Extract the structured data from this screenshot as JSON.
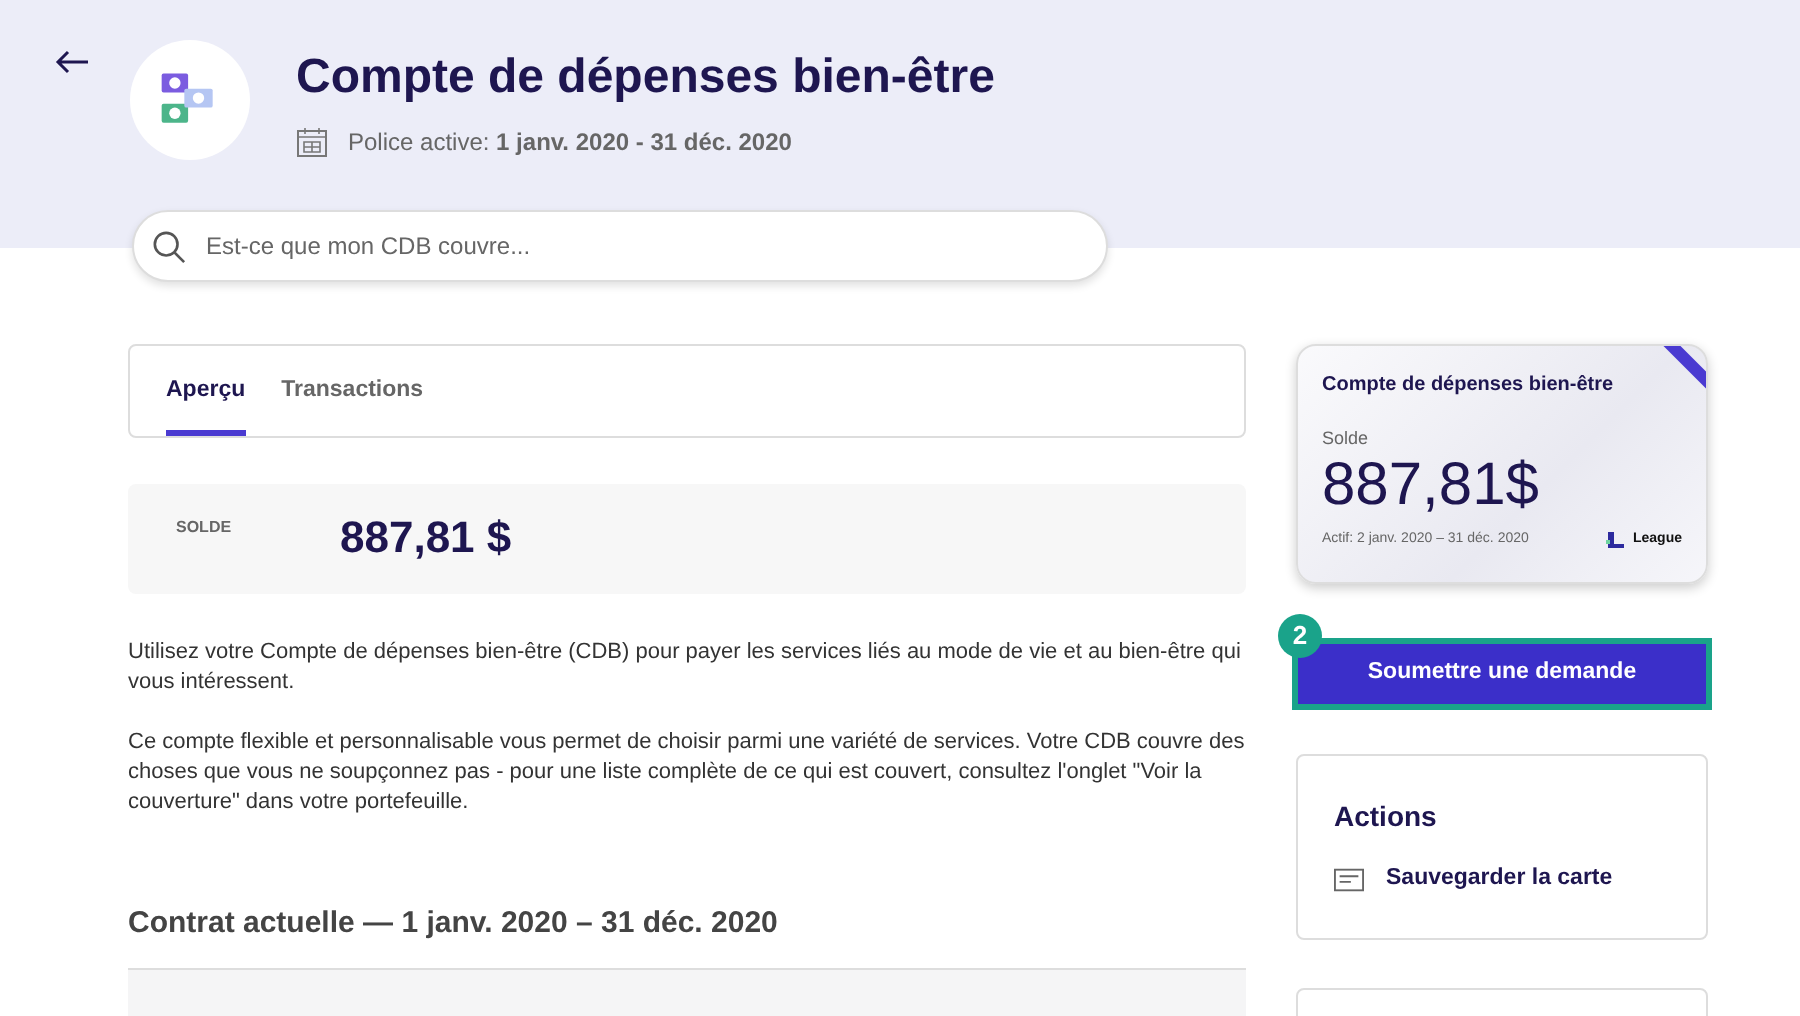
{
  "header": {
    "title": "Compte de dépenses bien-être",
    "policy": "Police active: **1 janv. 2020 - 31 déc. 2020**"
  },
  "search": {
    "placeholder": "Est-ce que mon CDB couvre..."
  },
  "tabs": [
    {
      "label": "Aperçu",
      "selected": true
    },
    {
      "label": "Transactions",
      "selected": false
    }
  ],
  "balance": {
    "label": "SOLDE",
    "amount": "887,81 $"
  },
  "paragraphs": [
    "Utilisez votre Compte de dépenses bien-être (CDB) pour payer les services liés au mode de vie et au bien-être qui vous intéressent.",
    "Ce compte flexible et personnalisable vous permet de choisir parmi une variété de services. Votre CDB couvre des choses que vous ne soupçonnez pas - pour une liste complète de ce qui est couvert, consultez l'onglet \"Voir la couverture\" dans votre portefeuille."
  ],
  "contract_heading": "Contrat actuelle — 1 janv. 2020 – 31 déc. 2020",
  "card": {
    "title": "Compte de dépenses bien-être",
    "balance_label": "Solde",
    "amount": "887,81$",
    "active": "Actif: 2 janv. 2020 – 31 déc. 2020",
    "brand": "League"
  },
  "step_badge": "2",
  "submit_button": "Soumettre une demande",
  "actions": {
    "title": "Actions",
    "items": [
      "Sauvegarder la carte"
    ]
  }
}
